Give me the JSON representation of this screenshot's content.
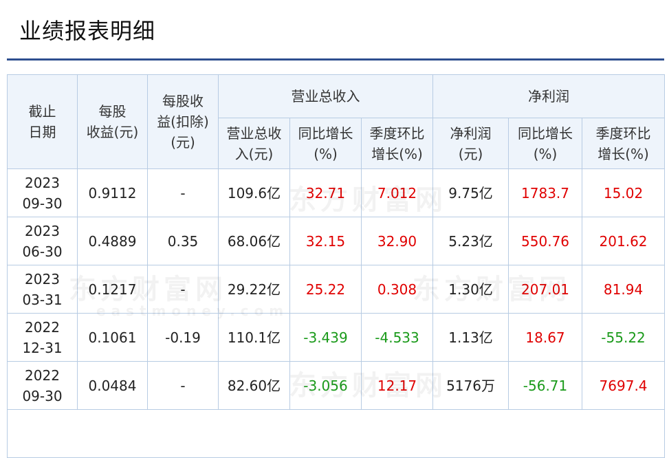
{
  "title": "业绩报表明细",
  "watermark": {
    "brand": "东方财富网",
    "site": "eastmoney.com"
  },
  "headers": {
    "date": "截止\n日期",
    "eps": "每股\n收益(元)",
    "eps_deducted": "每股收\n益(扣除)\n(元)",
    "revenue_group": "营业总收入",
    "revenue": "营业总收\n入(元)",
    "revenue_yoy": "同比增长\n(%)",
    "revenue_qoq": "季度环比\n增长(%)",
    "profit_group": "净利润",
    "profit": "净利润\n(元)",
    "profit_yoy": "同比增长\n(%)",
    "profit_qoq": "季度环比\n增长(%)"
  },
  "colors": {
    "positive": "#e00000",
    "negative": "#1a9a1a",
    "header_bg": "#eef4fb",
    "border": "#b7cbe3",
    "rule": "#2e4f8f"
  },
  "rows": [
    {
      "date": "2023\n09-30",
      "eps": "0.9112",
      "eps_deducted": "-",
      "revenue": "109.6亿",
      "revenue_yoy": "32.71",
      "revenue_qoq": "7.012",
      "profit": "9.75亿",
      "profit_yoy": "1783.7",
      "profit_qoq": "15.02"
    },
    {
      "date": "2023\n06-30",
      "eps": "0.4889",
      "eps_deducted": "0.35",
      "revenue": "68.06亿",
      "revenue_yoy": "32.15",
      "revenue_qoq": "32.90",
      "profit": "5.23亿",
      "profit_yoy": "550.76",
      "profit_qoq": "201.62"
    },
    {
      "date": "2023\n03-31",
      "eps": "0.1217",
      "eps_deducted": "-",
      "revenue": "29.22亿",
      "revenue_yoy": "25.22",
      "revenue_qoq": "0.308",
      "profit": "1.30亿",
      "profit_yoy": "207.01",
      "profit_qoq": "81.94"
    },
    {
      "date": "2022\n12-31",
      "eps": "0.1061",
      "eps_deducted": "-0.19",
      "revenue": "110.1亿",
      "revenue_yoy": "-3.439",
      "revenue_qoq": "-4.533",
      "profit": "1.13亿",
      "profit_yoy": "18.67",
      "profit_qoq": "-55.22"
    },
    {
      "date": "2022\n09-30",
      "eps": "0.0484",
      "eps_deducted": "-",
      "revenue": "82.60亿",
      "revenue_yoy": "-3.056",
      "revenue_qoq": "12.17",
      "profit": "5176万",
      "profit_yoy": "-56.71",
      "profit_qoq": "7697.4"
    }
  ]
}
